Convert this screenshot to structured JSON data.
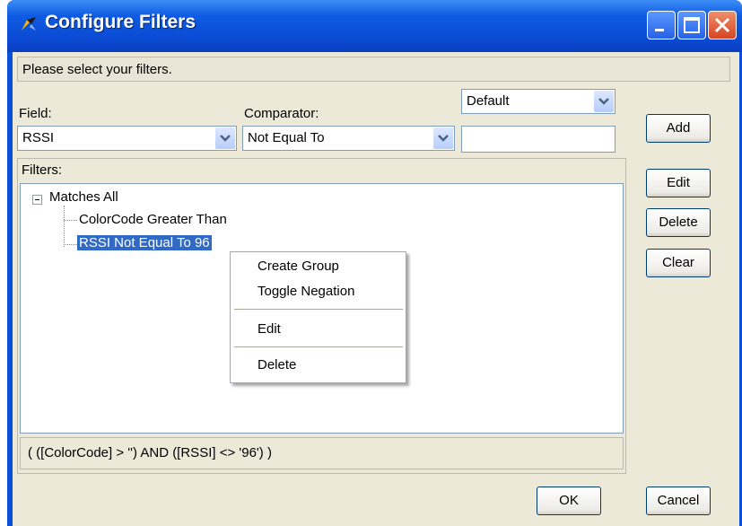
{
  "window": {
    "title": "Configure Filters",
    "colors": {
      "titlebar": "#0a4ad3",
      "client": "#ece9d8",
      "selection": "#316ac5",
      "close": "#d4451f"
    }
  },
  "titlebar_icons": [
    "app-icon",
    "minimize-icon",
    "maximize-icon",
    "close-icon"
  ],
  "info": {
    "text": "Please select your filters."
  },
  "form": {
    "field_label": "Field:",
    "field_value": "RSSI",
    "comparator_label": "Comparator:",
    "comparator_value": "Not Equal To",
    "value_mode": "Default",
    "value_text": ""
  },
  "buttons": {
    "add": "Add",
    "edit": "Edit",
    "delete": "Delete",
    "clear": "Clear",
    "ok": "OK",
    "cancel": "Cancel"
  },
  "filters": {
    "label": "Filters:",
    "root": "Matches All",
    "children": [
      "ColorCode Greater Than",
      "RSSI Not Equal To 96"
    ],
    "selected_child": "RSSI Not Equal To 96",
    "expression": "( ([ColorCode] > '') AND ([RSSI] <> '96') )"
  },
  "context_menu": {
    "items": [
      "Create Group",
      "Toggle Negation",
      "Edit",
      "Delete"
    ]
  }
}
